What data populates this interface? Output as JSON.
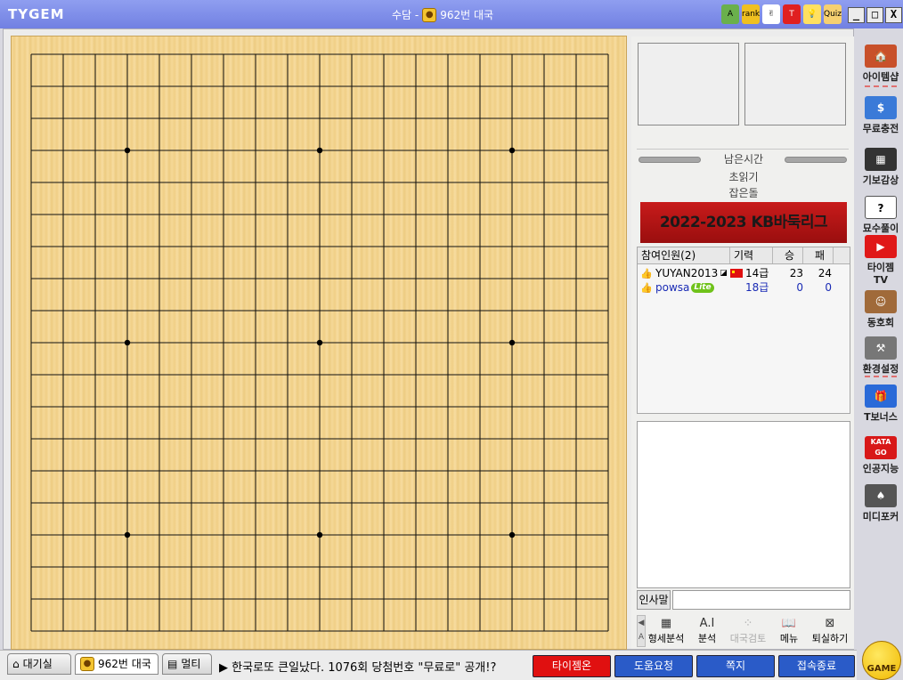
{
  "titlebar": {
    "logo": "TYGEM",
    "title_prefix": "수담 - ",
    "title_game": "962번 대국",
    "icons": [
      {
        "name": "home-icon",
        "text": "A"
      },
      {
        "name": "rank-icon",
        "text": "rank"
      },
      {
        "name": "hand-icon",
        "text": "✌"
      },
      {
        "name": "tygem-t-icon",
        "text": "T"
      },
      {
        "name": "lightbulb-icon",
        "text": "💡"
      },
      {
        "name": "quiz-icon",
        "text": "Quiz"
      }
    ],
    "min": "_",
    "max": "□",
    "close": "X"
  },
  "panel": {
    "time_label": "남은시간",
    "byoyomi_label": "초읽기",
    "captured_label": "잡은돌",
    "league_banner": "2022-2023 KB바둑리그"
  },
  "players": {
    "header": [
      "참여인원(2)",
      "기력",
      "승",
      "패"
    ],
    "rows": [
      {
        "name": "YUYAN2013",
        "rank": "14급",
        "wins": "23",
        "losses": "24",
        "flag": true,
        "lite": false,
        "blue": false
      },
      {
        "name": "powsa",
        "rank": "18급",
        "wins": "0",
        "losses": "0",
        "flag": false,
        "lite": true,
        "blue": true
      }
    ],
    "lite_label": "Lite"
  },
  "greeting": {
    "label": "인사말",
    "value": ""
  },
  "tools": [
    {
      "label": "형세분석",
      "icon": "▦",
      "name": "position-analysis-button",
      "dim": false
    },
    {
      "label": "분석",
      "icon": "A.I",
      "name": "ai-analysis-button",
      "dim": false
    },
    {
      "label": "대국검토",
      "icon": "⁘",
      "name": "game-review-button",
      "dim": true
    },
    {
      "label": "메뉴",
      "icon": "📖",
      "name": "menu-button",
      "dim": false
    },
    {
      "label": "퇴실하기",
      "icon": "⊠",
      "name": "leave-button",
      "dim": false
    }
  ],
  "sidebar": [
    {
      "label": "아이템샵",
      "icon": "🏠",
      "name": "item-shop",
      "color": "#c8502a"
    },
    {
      "label": "무료충전",
      "icon": "$",
      "name": "free-charge",
      "color": "#3a7ad8"
    },
    {
      "label": "기보감상",
      "icon": "▦",
      "name": "game-records",
      "color": "#333333"
    },
    {
      "label": "묘수풀이",
      "icon": "?",
      "name": "problems",
      "color": "#ffffff"
    },
    {
      "label": "타이젬TV",
      "icon": "▶",
      "name": "tygem-tv",
      "color": "#e01818"
    },
    {
      "label": "동호회",
      "icon": "☺",
      "name": "club",
      "color": "#a06a3a"
    },
    {
      "label": "환경설정",
      "icon": "⚒",
      "name": "settings",
      "color": "#777777"
    },
    {
      "label": "T보너스",
      "icon": "🎁",
      "name": "t-bonus",
      "color": "#2a6ad8"
    },
    {
      "label": "인공지능",
      "icon": "KATA GO",
      "name": "ai-katago",
      "color": "#d81818"
    },
    {
      "label": "미디포커",
      "icon": "♠",
      "name": "media-poker",
      "color": "#555555"
    }
  ],
  "bottom": {
    "tabs": [
      {
        "label": "대기실",
        "name": "tab-waiting-room"
      },
      {
        "label": "962번 대국",
        "name": "tab-game-962"
      },
      {
        "label": "멀티",
        "name": "tab-multi"
      }
    ],
    "ticker": "▶ 한국로또 큰일났다. 1076회 당첨번호 \"무료로\" 공개!?",
    "buttons": [
      {
        "label": "타이젬온",
        "name": "tygem-on-button",
        "color": "#e01010"
      },
      {
        "label": "도움요청",
        "name": "help-request-button",
        "color": "#2a5bc8"
      },
      {
        "label": "쪽지",
        "name": "message-button",
        "color": "#2a5bc8"
      },
      {
        "label": "접속종료",
        "name": "disconnect-button",
        "color": "#2a5bc8"
      }
    ],
    "game_label": "GAME"
  }
}
